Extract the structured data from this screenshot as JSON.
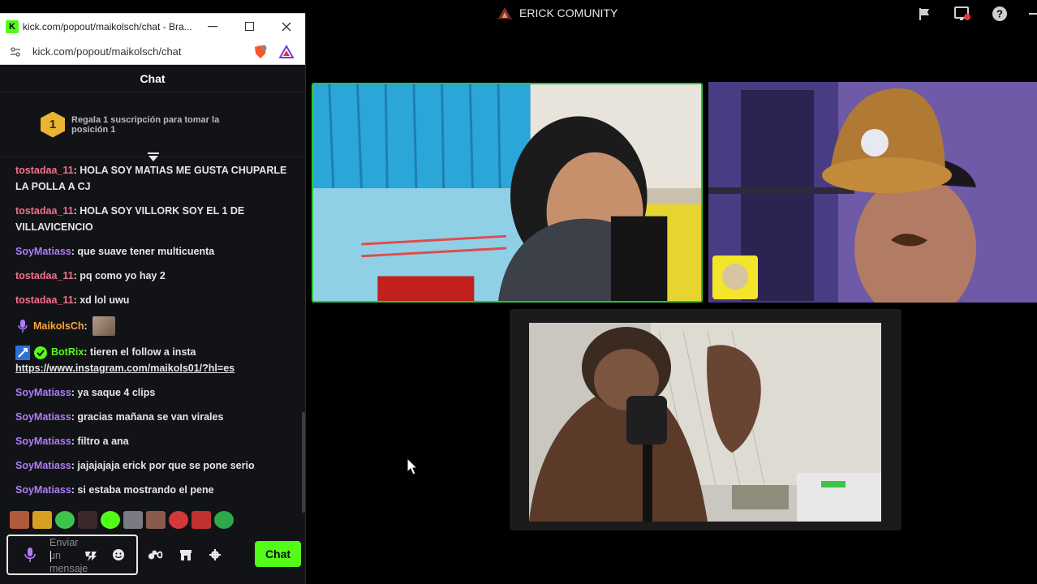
{
  "call": {
    "title": "ERICK COMUNITY",
    "icons": [
      "flag-icon",
      "screen-record-icon",
      "help-icon",
      "minimize-icon"
    ]
  },
  "browser": {
    "window_title": "kick.com/popout/maikolsch/chat - Bra...",
    "url": "kick.com/popout/maikolsch/chat",
    "favicon": "K"
  },
  "chat": {
    "header": "Chat",
    "gift": {
      "rank": "1",
      "text": "Regala 1 suscripción para tomar la posición 1"
    },
    "messages": [
      {
        "user": "tostadaa_11",
        "text": "HOLA SOY MATIAS ME GUSTA CHUPARLE LA POLLA A CJ",
        "color": "#f36f8c"
      },
      {
        "user": "tostadaa_11",
        "text": "HOLA SOY VILLORK SOY EL 1 DE VILLAVICENCIO",
        "color": "#f36f8c"
      },
      {
        "user": "SoyMatiass",
        "text": "que suave tener multicuenta",
        "color": "#b07cfb"
      },
      {
        "user": "tostadaa_11",
        "text": "pq como yo hay 2",
        "color": "#f36f8c"
      },
      {
        "user": "tostadaa_11",
        "text": "xd lol uwu",
        "color": "#f36f8c"
      },
      {
        "user": "MaikolsCh",
        "text": "",
        "color": "#f9a53b"
      },
      {
        "user": "BotRix",
        "text": "tieren el follow a insta",
        "link": "https://www.instagram.com/maikols01/?hl=es",
        "color": "#53fc18"
      },
      {
        "user": "SoyMatiass",
        "text": "ya saque 4 clips",
        "color": "#b07cfb"
      },
      {
        "user": "SoyMatiass",
        "text": "gracias mañana se van virales",
        "color": "#b07cfb"
      },
      {
        "user": "SoyMatiass",
        "text": "filtro a ana",
        "color": "#b07cfb"
      },
      {
        "user": "SoyMatiass",
        "text": "jajajajaja erick por que se pone serio",
        "color": "#b07cfb"
      },
      {
        "user": "SoyMatiass",
        "text": "si estaba mostrando el pene",
        "color": "#b07cfb"
      }
    ],
    "input_placeholder": "Enviar un mensaje",
    "send_label": "Chat",
    "accent": "#53fc18"
  }
}
